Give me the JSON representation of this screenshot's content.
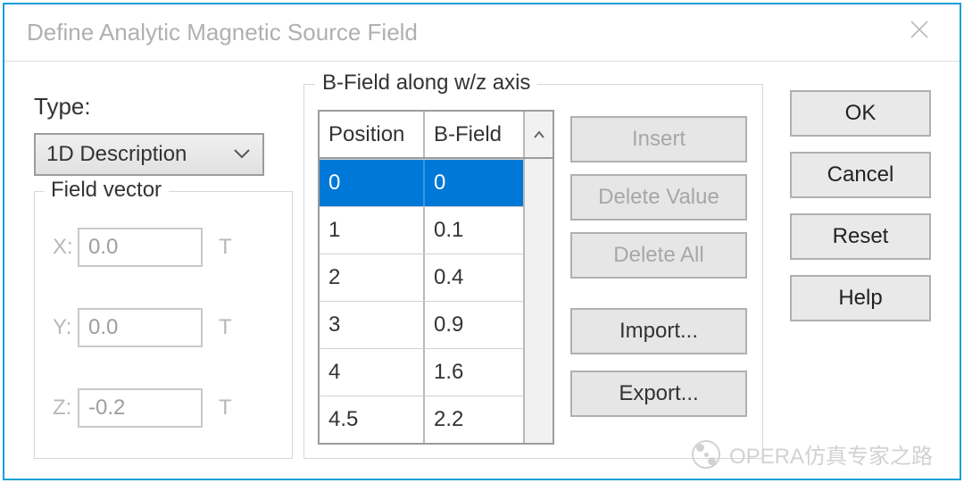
{
  "window": {
    "title": "Define Analytic Magnetic Source Field"
  },
  "type": {
    "label": "Type:",
    "selected": "1D Description"
  },
  "field_vector": {
    "legend": "Field vector",
    "rows": {
      "x": {
        "label": "X:",
        "value": "0.0",
        "unit": "T"
      },
      "y": {
        "label": "Y:",
        "value": "0.0",
        "unit": "T"
      },
      "z": {
        "label": "Z:",
        "value": "-0.2",
        "unit": "T"
      }
    }
  },
  "bfield": {
    "legend": "B-Field along w/z axis",
    "headers": {
      "position": "Position",
      "bfield": "B-Field"
    },
    "rows": [
      {
        "position": "0",
        "bfield": "0",
        "selected": true
      },
      {
        "position": "1",
        "bfield": "0.1",
        "selected": false
      },
      {
        "position": "2",
        "bfield": "0.4",
        "selected": false
      },
      {
        "position": "3",
        "bfield": "0.9",
        "selected": false
      },
      {
        "position": "4",
        "bfield": "1.6",
        "selected": false
      },
      {
        "position": "4.5",
        "bfield": "2.2",
        "selected": false
      }
    ],
    "buttons": {
      "insert": "Insert",
      "delete_value": "Delete Value",
      "delete_all": "Delete All",
      "import": "Import...",
      "export": "Export..."
    }
  },
  "dialog_buttons": {
    "ok": "OK",
    "cancel": "Cancel",
    "reset": "Reset",
    "help": "Help"
  },
  "watermark": "OPERA仿真专家之路"
}
